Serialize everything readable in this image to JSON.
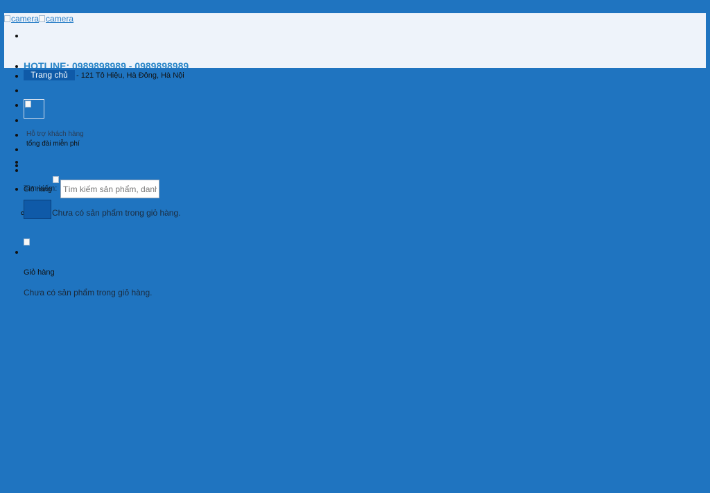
{
  "header": {
    "logo_alt_1": "camera",
    "logo_alt_2": "camera",
    "hotline": "HOTLINE: 0989898989 - 0989898989",
    "home_label": "Trang chủ",
    "address": "- 121 Tô Hiệu, Hà Đông, Hà Nội"
  },
  "support": {
    "line1": "Hỗ trợ khách hàng",
    "line2": "tổng đài miễn phí"
  },
  "search": {
    "label": "Tìm kiếm:",
    "placeholder": "Tìm kiếm sản phẩm, danh mục..."
  },
  "cart": {
    "small_label": "Giỏ hàng",
    "empty_text_inline": "Chưa có sản phẩm trong giỏ hàng.",
    "title": "Giỏ hàng",
    "empty_text": "Chưa có sản phẩm trong giỏ hàng."
  },
  "colors": {
    "page_background": "#1f74c0",
    "topbar_background": "#eef3fa",
    "accent_button": "#0f5aa8",
    "hotline_text": "#2a86c8"
  }
}
